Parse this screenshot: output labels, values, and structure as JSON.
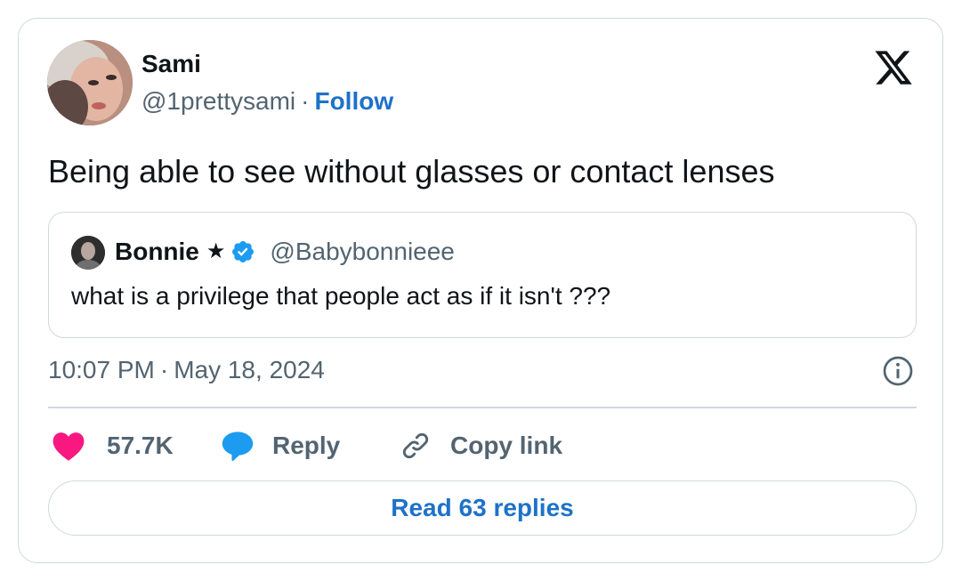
{
  "author": {
    "name": "Sami",
    "handle": "@1prettysami",
    "separator": "·",
    "follow_label": "Follow",
    "avatar_icon": "user-avatar-photo"
  },
  "brand": {
    "logo_icon": "x-logo-icon"
  },
  "tweet": {
    "text": "Being able to see without glasses or contact lenses",
    "time": "10:07 PM",
    "separator": "·",
    "date": "May 18, 2024"
  },
  "quoted": {
    "name": "Bonnie",
    "star": "★",
    "verified_icon": "verified-badge-icon",
    "handle": "@Babybonnieee",
    "text": "what is a privilege that people act as if it isn't ???"
  },
  "actions": {
    "like_count": "57.7K",
    "reply_label": "Reply",
    "copy_link_label": "Copy link"
  },
  "footer": {
    "read_replies_label": "Read 63 replies"
  },
  "colors": {
    "accent": "#1d72c9",
    "like": "#f91880",
    "reply": "#1d9bf0",
    "muted": "#536471",
    "border": "#cfd9de",
    "text": "#0f1419"
  }
}
